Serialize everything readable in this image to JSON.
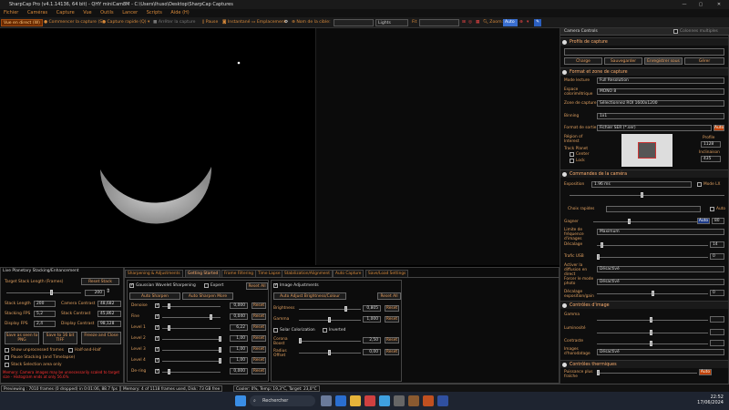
{
  "window": {
    "title": "SharpCap Pro (v4.1.14136, 64 bit) - QHY miniCam8M - C:\\Users\\lhuso\\Desktop\\SharpCap Captures"
  },
  "menu": [
    "Fichier",
    "Caméras",
    "Capture",
    "Vue",
    "Outils",
    "Lancer",
    "Scripts",
    "Aide (H)"
  ],
  "toolbar": {
    "live": "Vue en direct (W)",
    "start_capture": "Commencer la capture (S)",
    "quick_capture": "Capture rapide (Q)",
    "stop_capture": "Arrêter la capture",
    "pause": "Pause",
    "snapshot": "Instantané",
    "location": "Emplacement",
    "target_label": "Nom de la cible:",
    "target_value": "",
    "frame_type": "Lights",
    "fit_label": "Fit",
    "zoom_label": "Zoom:",
    "zoom_value": "Auto"
  },
  "stacking": {
    "title": "Live Planetary Stacking/Enhancement",
    "target_stack_length_label": "Target Stack Length (Frames)",
    "reset_stack": "Reset Stack",
    "target_value": "200",
    "stack_length_label": "Stack Length",
    "stack_length": "200",
    "stacking_fps_label": "Stacking FPS",
    "stacking_fps": "5,2",
    "display_fps_label": "Display FPS",
    "display_fps": "2,4",
    "camera_contrast_label": "Camera Contrast",
    "camera_contrast": "48,682",
    "stack_contrast_label": "Stack Contrast",
    "stack_contrast": "45,862",
    "display_contrast_label": "Display Contrast",
    "display_contrast": "98,128",
    "save_png": "Save as seen to PNG",
    "save_tiff": "Save to 16 bit TIFF",
    "freeze_close": "Freeze and Close",
    "opt_unprocessed": "Show unprocessed frames",
    "opt_halfhalf": "Half-and-Half",
    "opt_pause": "Pause Stacking (and Timelapse)",
    "opt_selection": "Stack Selection area only",
    "warning": "Memory: Camera images may be unnecessarily scaled to target size - Histogram ends at only 56.6%"
  },
  "tabs": [
    "Sharpening & Adjustments",
    "Getting Started",
    "Frame Filtering",
    "Time Lapse",
    "Stabilization/Alignment",
    "Auto Capture",
    "Save/Load Settings"
  ],
  "sharpening": {
    "gaussian": "Gaussian Wavelet Sharpening",
    "expert": "Expert",
    "reset_all": "Reset All",
    "auto_sharpen": "Auto Sharpen",
    "auto_sharpen_more": "Auto Sharpen More",
    "rows": [
      {
        "label": "Denoise",
        "value": "0,000"
      },
      {
        "label": "Fine",
        "value": "0,040"
      },
      {
        "label": "Level 1",
        "value": "6,22"
      },
      {
        "label": "Level 2",
        "value": "1,00"
      },
      {
        "label": "Level 3",
        "value": "1,00"
      },
      {
        "label": "Level 4",
        "value": "1,00"
      },
      {
        "label": "De-ring",
        "value": "0,000"
      }
    ],
    "reset": "Reset"
  },
  "image_adjust": {
    "title": "Image Adjustments",
    "auto_adjust": "Auto Adjust Brightness/Colour",
    "reset_all": "Reset All",
    "brightness_label": "Brightness",
    "brightness": "0,805",
    "gamma_label": "Gamma",
    "gamma": "1,000",
    "solar": "Solar Colorization",
    "inverted": "Inverted",
    "corona_label": "Corona Boost",
    "corona": "2,50",
    "radius_label": "Radius Offset",
    "radius": "0,00",
    "reset": "Reset"
  },
  "camera_controls": {
    "title": "Camera Controls",
    "multi_cols": "Colonnes multiples",
    "profile_section": "Profils de capture",
    "charge": "Charge",
    "save": "Sauvegarder",
    "save_as": "Enregistrer sous",
    "manage": "Gérer",
    "format_section": "Format et zone de capture",
    "mode_label": "Mode lecture",
    "mode_value": "Full Resolution",
    "colorspace_label": "Espace colorimétrique",
    "colorspace_value": "MONO 8",
    "zone_label": "Zone de capture",
    "zone_value": "Sélectionnez ROI  1600x1200",
    "binning_label": "Binning",
    "binning_value": "1x1",
    "output_label": "Format de sortie",
    "output_value": "Fichier SER (*.ser)",
    "auto": "Auto",
    "roi_label": "Région of Interest",
    "track_planet": "Track Planet",
    "center": "Center",
    "lock": "Lock",
    "width_label": "Profile",
    "width_value": "1128",
    "height_label": "Inclinaison",
    "height_value": "435",
    "camera_section": "Commandes de la caméra",
    "exposure_label": "Exposition",
    "exposure_value": "1.96 ms",
    "mode_lx": "Mode LX",
    "quick_choice": "Choix rapides",
    "gain_label": "Gagner",
    "gain_value": "80",
    "limit_label": "Limite de fréquence d'images",
    "limit_value": "Maximum",
    "offset_label": "Décalage",
    "offset_value": "14",
    "usb_label": "Trafic USB",
    "usb_value": "0",
    "diffusion_label": "Activer la diffusion en direct",
    "diffusion_value": "Désactivé",
    "photo_label": "Forcer le mode photo",
    "photo_value": "Désactivé",
    "offset_exp_label": "Décalage exposition/gain",
    "offset_exp_value": "0",
    "image_section": "Contrôles d'image",
    "gamma_label": "Gamma",
    "lum_label": "Luminosité",
    "contrast_label": "Contraste",
    "bgimg_label": "Images d'horodatage",
    "bgimg_value": "Désactivé",
    "thermal_section": "Contrôles thermiques",
    "power_label": "Puissance plus fraîche",
    "power_value": "Auto"
  },
  "status": {
    "previewing": "Previewing : 7010 frames (0 dropped) in 0:01:06, 88.7 fps",
    "memory": "Memory: 4 of 1118 frames used, Disk: 73 GB free",
    "cooler": "Cooler: 0%, Temp: 19,3°C, Target: 23,0°C"
  },
  "taskbar": {
    "search": "Rechercher",
    "time": "22:52",
    "date": "17/06/2024"
  }
}
